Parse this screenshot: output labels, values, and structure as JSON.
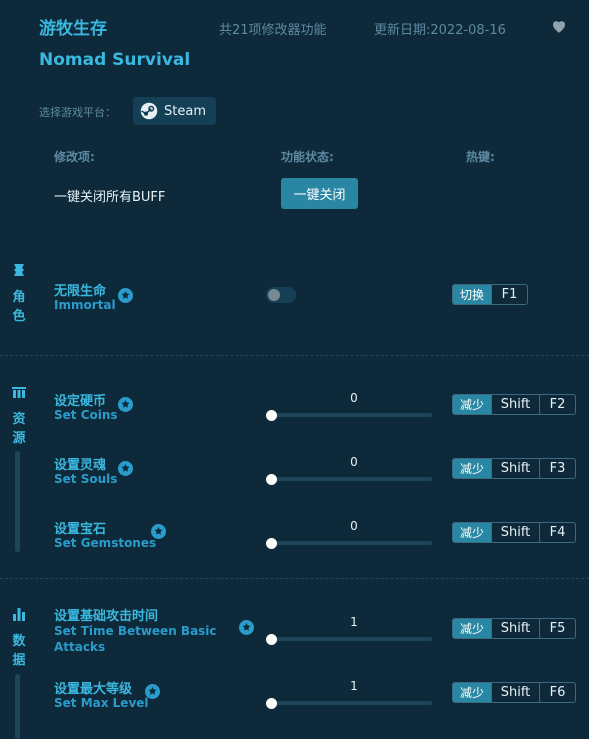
{
  "header": {
    "title_cn": "游牧生存",
    "title_en": "Nomad Survival",
    "feature_count": "共21项修改器功能",
    "update_date": "更新日期:2022-08-16",
    "favorite_icon": "heart-icon"
  },
  "platform": {
    "label": "选择游戏平台：",
    "selected": "Steam",
    "icon": "steam-icon"
  },
  "columns": {
    "option": "修改项:",
    "status": "功能状态:",
    "hotkey": "热键:"
  },
  "global": {
    "label": "一键关闭所有BUFF",
    "button": "一键关闭"
  },
  "categories": [
    {
      "icon": "character-icon",
      "name": [
        "角",
        "色"
      ]
    },
    {
      "icon": "resources-icon",
      "name": [
        "资",
        "源"
      ]
    },
    {
      "icon": "data-icon",
      "name": [
        "数",
        "据"
      ]
    }
  ],
  "options": [
    {
      "cn": "无限生命",
      "en": "Immortal",
      "control": "toggle",
      "on": false,
      "hotkey": {
        "action": "切换",
        "keys": [
          "F1"
        ]
      }
    },
    {
      "cn": "设定硬币",
      "en": "Set Coins",
      "control": "slider",
      "value": "0",
      "level": 0,
      "hotkey": {
        "action": "减少",
        "keys": [
          "Shift",
          "F2"
        ]
      }
    },
    {
      "cn": "设置灵魂",
      "en": "Set Souls",
      "control": "slider",
      "value": "0",
      "level": 0,
      "hotkey": {
        "action": "减少",
        "keys": [
          "Shift",
          "F3"
        ]
      }
    },
    {
      "cn": "设置宝石",
      "en": "Set Gemstones",
      "control": "slider",
      "value": "0",
      "level": 0,
      "hotkey": {
        "action": "减少",
        "keys": [
          "Shift",
          "F4"
        ]
      }
    },
    {
      "cn": "设置基础攻击时间",
      "en_line1": "Set Time Between Basic",
      "en_line2": "Attacks",
      "control": "slider",
      "value": "1",
      "level": 0,
      "hotkey": {
        "action": "减少",
        "keys": [
          "Shift",
          "F5"
        ]
      }
    },
    {
      "cn": "设置最大等级",
      "en": "Set Max Level",
      "control": "slider",
      "value": "1",
      "level": 0,
      "hotkey": {
        "action": "减少",
        "keys": [
          "Shift",
          "F6"
        ]
      }
    }
  ],
  "colors": {
    "background": "#0e2a3a",
    "accent": "#3ab8e0",
    "button": "#2a87a4"
  }
}
